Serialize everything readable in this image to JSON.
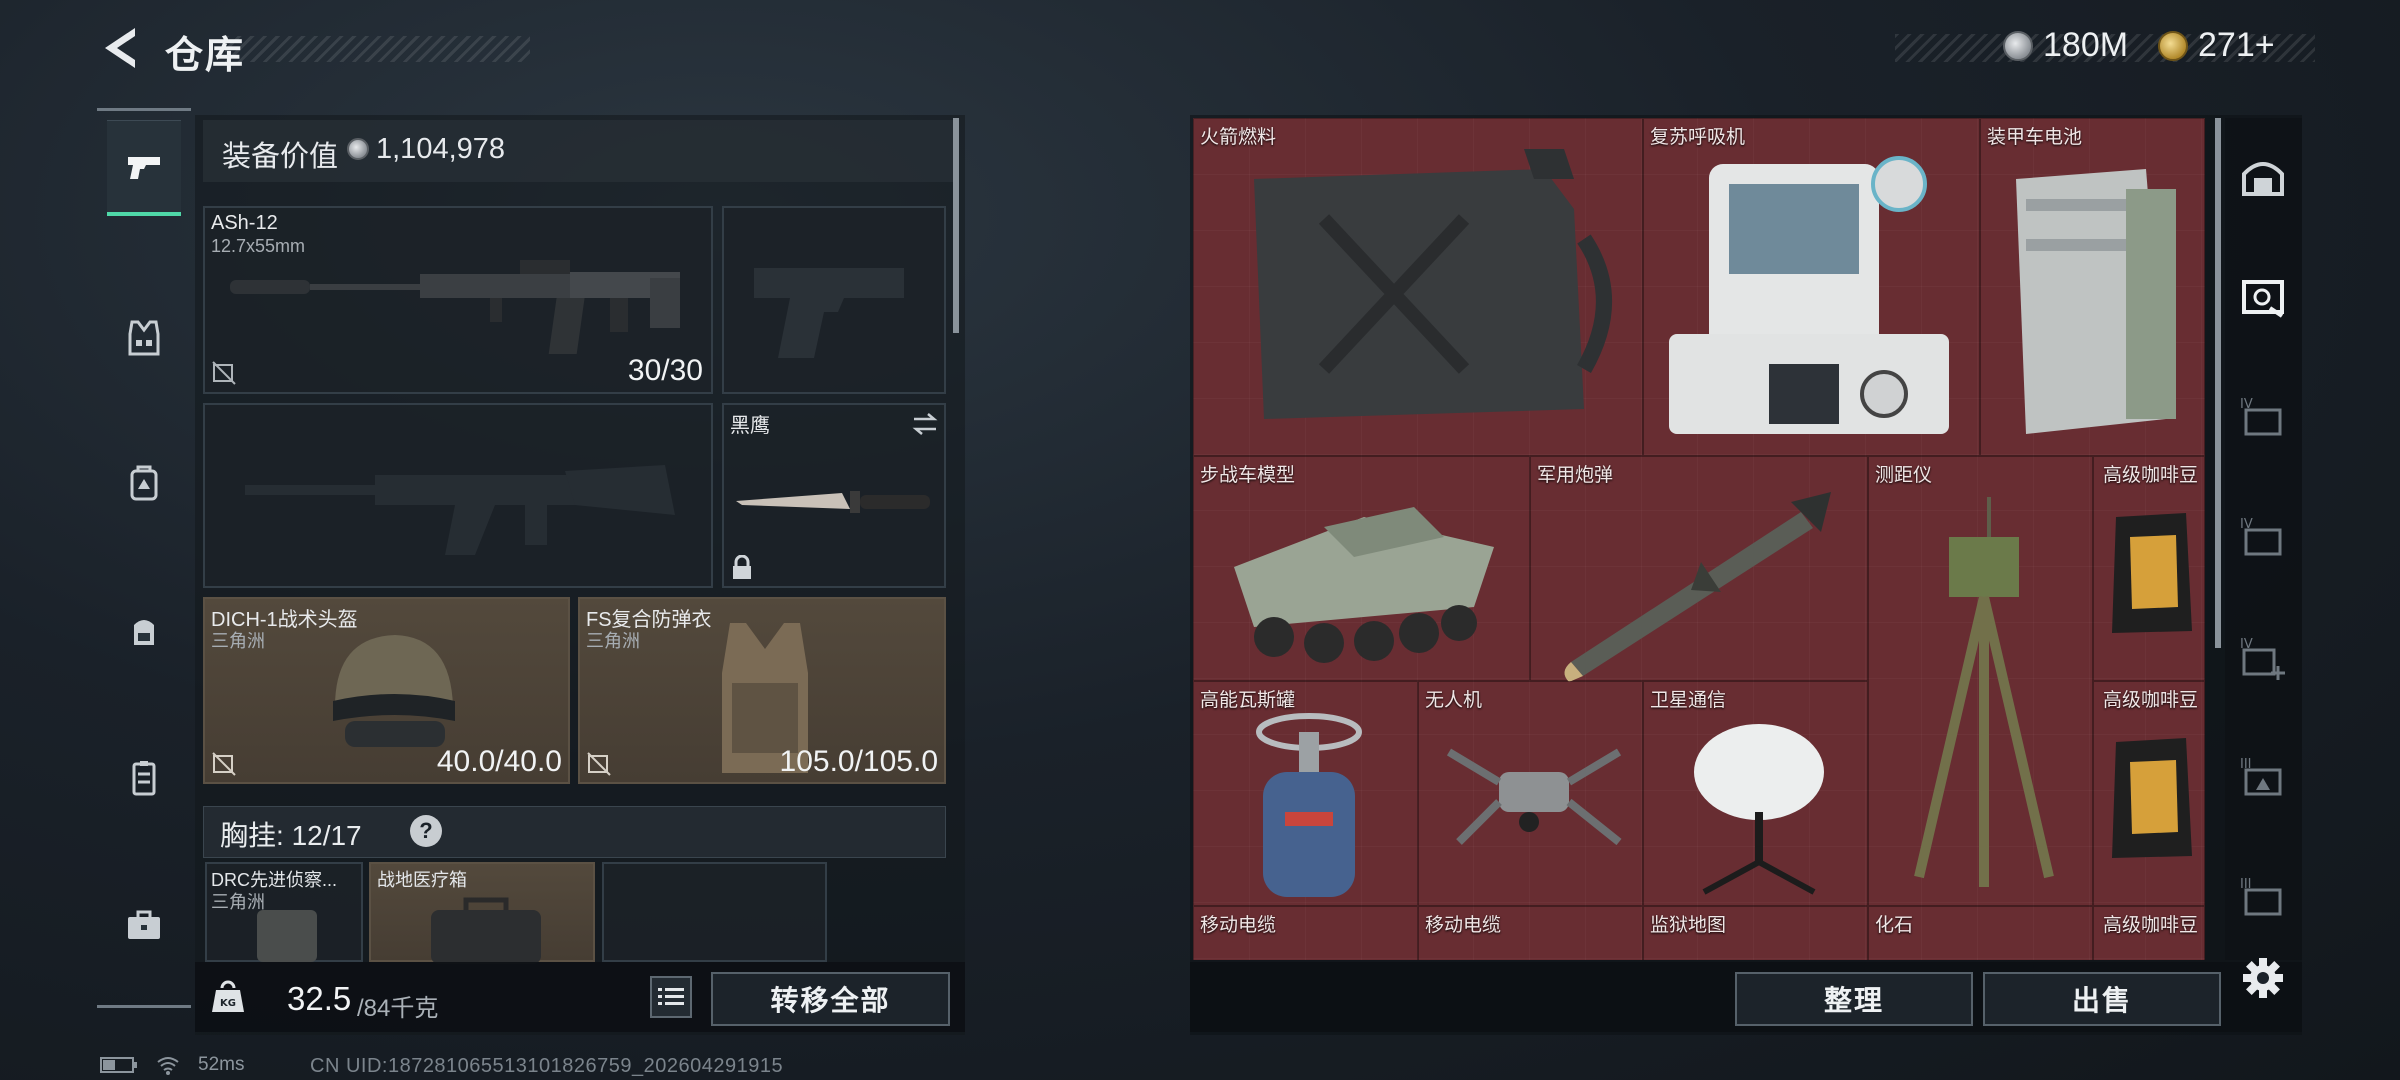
{
  "header": {
    "title": "仓库",
    "currencies": [
      {
        "icon": "silver-coin-icon",
        "value": "180M"
      },
      {
        "icon": "gold-coin-icon",
        "value": "271+"
      }
    ]
  },
  "left_nav": {
    "items": [
      {
        "icon": "pistol-icon",
        "active": true
      },
      {
        "icon": "armor-vest-icon",
        "active": false
      },
      {
        "icon": "backpack-rig-icon",
        "active": false
      },
      {
        "icon": "backpack-icon",
        "active": false
      },
      {
        "icon": "case-icon",
        "active": false
      },
      {
        "icon": "toolbox-icon",
        "active": false
      }
    ]
  },
  "loadout": {
    "equip_value_label": "装备价值",
    "equip_value": "1,104,978",
    "primary_weapon": {
      "name": "ASh-12",
      "caliber": "12.7x55mm",
      "ammo": "30/30"
    },
    "melee": {
      "name": "黑鹰"
    },
    "helmet": {
      "name": "DICH-1战术头盔",
      "map": "三角洲",
      "durability": "40.0/40.0"
    },
    "armor": {
      "name": "FS复合防弹衣",
      "map": "三角洲",
      "durability": "105.0/105.0"
    },
    "rig": {
      "label": "胸挂:",
      "capacity": "12/17",
      "help": "?"
    },
    "rig_items": [
      {
        "name": "DRC先进侦察...",
        "map": "三角洲"
      },
      {
        "name": "战地医疗箱",
        "map": ""
      }
    ],
    "weight_current": "32.5",
    "weight_max": "/84千克",
    "transfer_all": "转移全部"
  },
  "warehouse": {
    "items": [
      {
        "name": "火箭燃料",
        "icon": "jerrycan-icon"
      },
      {
        "name": "复苏呼吸机",
        "icon": "ventilator-icon"
      },
      {
        "name": "装甲车电池",
        "icon": "battery-icon"
      },
      {
        "name": "步战车模型",
        "icon": "ifv-model-icon"
      },
      {
        "name": "军用炮弹",
        "icon": "missile-icon"
      },
      {
        "name": "测距仪",
        "icon": "rangefinder-icon"
      },
      {
        "name": "高级咖啡豆",
        "icon": "coffee-bag-icon"
      },
      {
        "name": "高能瓦斯罐",
        "icon": "gas-canister-icon"
      },
      {
        "name": "无人机",
        "icon": "drone-icon"
      },
      {
        "name": "卫星通信",
        "icon": "satellite-dish-icon"
      },
      {
        "name": "高级咖啡豆",
        "icon": "coffee-bag-icon"
      },
      {
        "name": "移动电缆",
        "icon": "cable-icon"
      },
      {
        "name": "移动电缆",
        "icon": "cable-icon"
      },
      {
        "name": "监狱地图",
        "icon": "map-icon"
      },
      {
        "name": "化石",
        "icon": "fossil-icon"
      },
      {
        "name": "高级咖啡豆",
        "icon": "coffee-bag-icon"
      }
    ],
    "sort_label": "整理",
    "sell_label": "出售"
  },
  "right_nav": {
    "items": [
      {
        "icon": "stash-icon"
      },
      {
        "icon": "safe-box-icon"
      },
      {
        "icon": "container-iv-icon-1"
      },
      {
        "icon": "container-iv-icon-2"
      },
      {
        "icon": "container-iv-add-icon"
      },
      {
        "icon": "container-iii-icon-1"
      },
      {
        "icon": "container-iii-icon-2"
      }
    ]
  },
  "status": {
    "ping": "52ms",
    "uid": "CN UID:18728106551310182675​9_202604291915"
  },
  "colors": {
    "accent": "#4fd8a8",
    "warehouse_cell": "#5c2a2e",
    "tan_slot": "#53493c"
  }
}
